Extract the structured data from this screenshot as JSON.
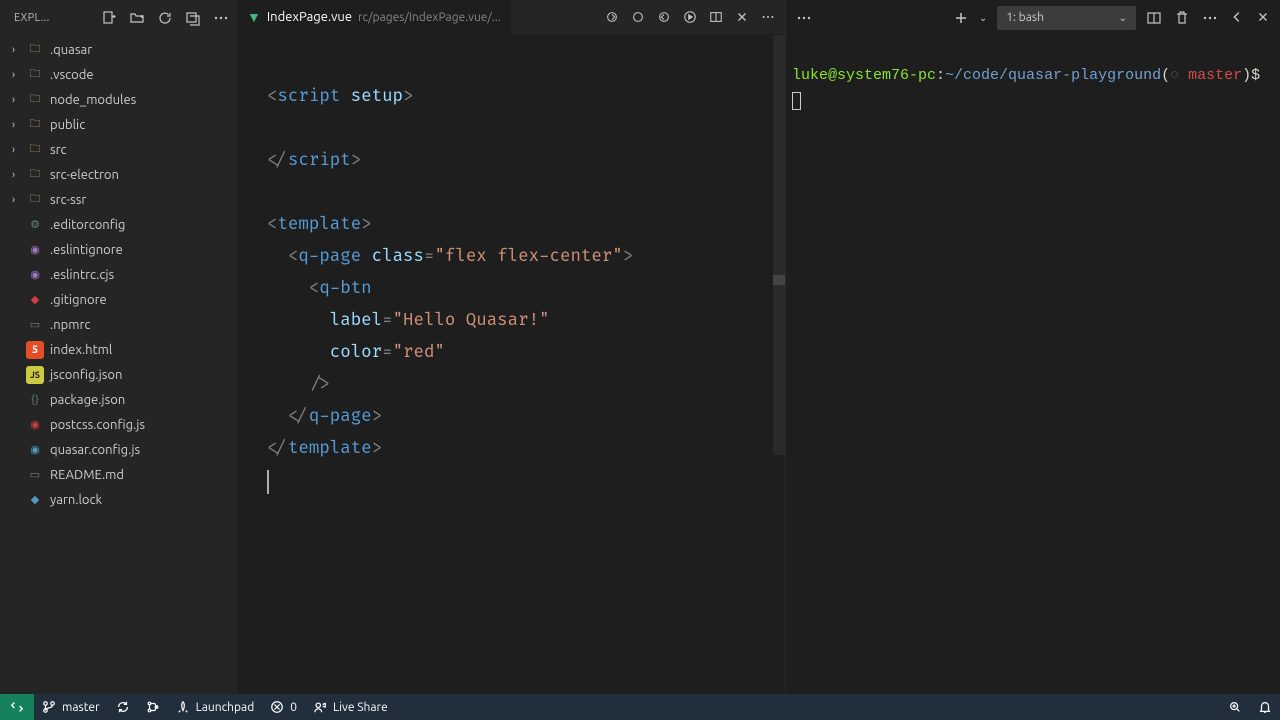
{
  "sidebar": {
    "title": "EXPL...",
    "folders": [
      {
        "label": ".quasar"
      },
      {
        "label": ".vscode"
      },
      {
        "label": "node_modules"
      },
      {
        "label": "public"
      },
      {
        "label": "src"
      },
      {
        "label": "src-electron"
      },
      {
        "label": "src-ssr"
      }
    ],
    "files": [
      {
        "label": ".editorconfig",
        "icon": "grey"
      },
      {
        "label": ".eslintignore",
        "icon": "purple"
      },
      {
        "label": ".eslintrc.cjs",
        "icon": "purple"
      },
      {
        "label": ".gitignore",
        "icon": "red"
      },
      {
        "label": ".npmrc",
        "icon": "grey"
      },
      {
        "label": "index.html",
        "icon": "orange",
        "badge": "5"
      },
      {
        "label": "jsconfig.json",
        "icon": "yellow",
        "badge": "JS"
      },
      {
        "label": "package.json",
        "icon": "grey"
      },
      {
        "label": "postcss.config.js",
        "icon": "red"
      },
      {
        "label": "quasar.config.js",
        "icon": "blue"
      },
      {
        "label": "README.md",
        "icon": "grey"
      },
      {
        "label": "yarn.lock",
        "icon": "blue"
      }
    ]
  },
  "editor": {
    "tab_name": "IndexPage.vue",
    "tab_path": "rc/pages/IndexPage.vue/...",
    "code": {
      "l1": {
        "o": "<",
        "t": "script",
        "a": " setup",
        "c": ">"
      },
      "l3": {
        "o": "</",
        "t": "script",
        "c": ">"
      },
      "l5": {
        "o": "<",
        "t": "template",
        "c": ">"
      },
      "l6": {
        "o": "<",
        "t": "q-page",
        "a": " class",
        "eq": "=",
        "s": "\"flex flex-center\"",
        "c": ">"
      },
      "l7": {
        "o": "<",
        "t": "q-btn"
      },
      "l8": {
        "a": "label",
        "eq": "=",
        "s": "\"Hello Quasar!\""
      },
      "l9": {
        "a": "color",
        "eq": "=",
        "s": "\"red\""
      },
      "l10": {
        "c": "/>"
      },
      "l11": {
        "o": "</",
        "t": "q-page",
        "c": ">"
      },
      "l12": {
        "o": "</",
        "t": "template",
        "c": ">"
      }
    }
  },
  "terminal": {
    "shell_label": "1: bash",
    "prompt": {
      "userhost": "luke@system76-pc",
      "colon": ":",
      "path": "~/code/quasar-playground",
      "branch_open": "(",
      "branch": "master",
      "branch_close": ")",
      "sym": "$ "
    }
  },
  "status": {
    "branch": "master",
    "problems": "0",
    "launchpad": "Launchpad",
    "liveshare": "Live Share"
  }
}
